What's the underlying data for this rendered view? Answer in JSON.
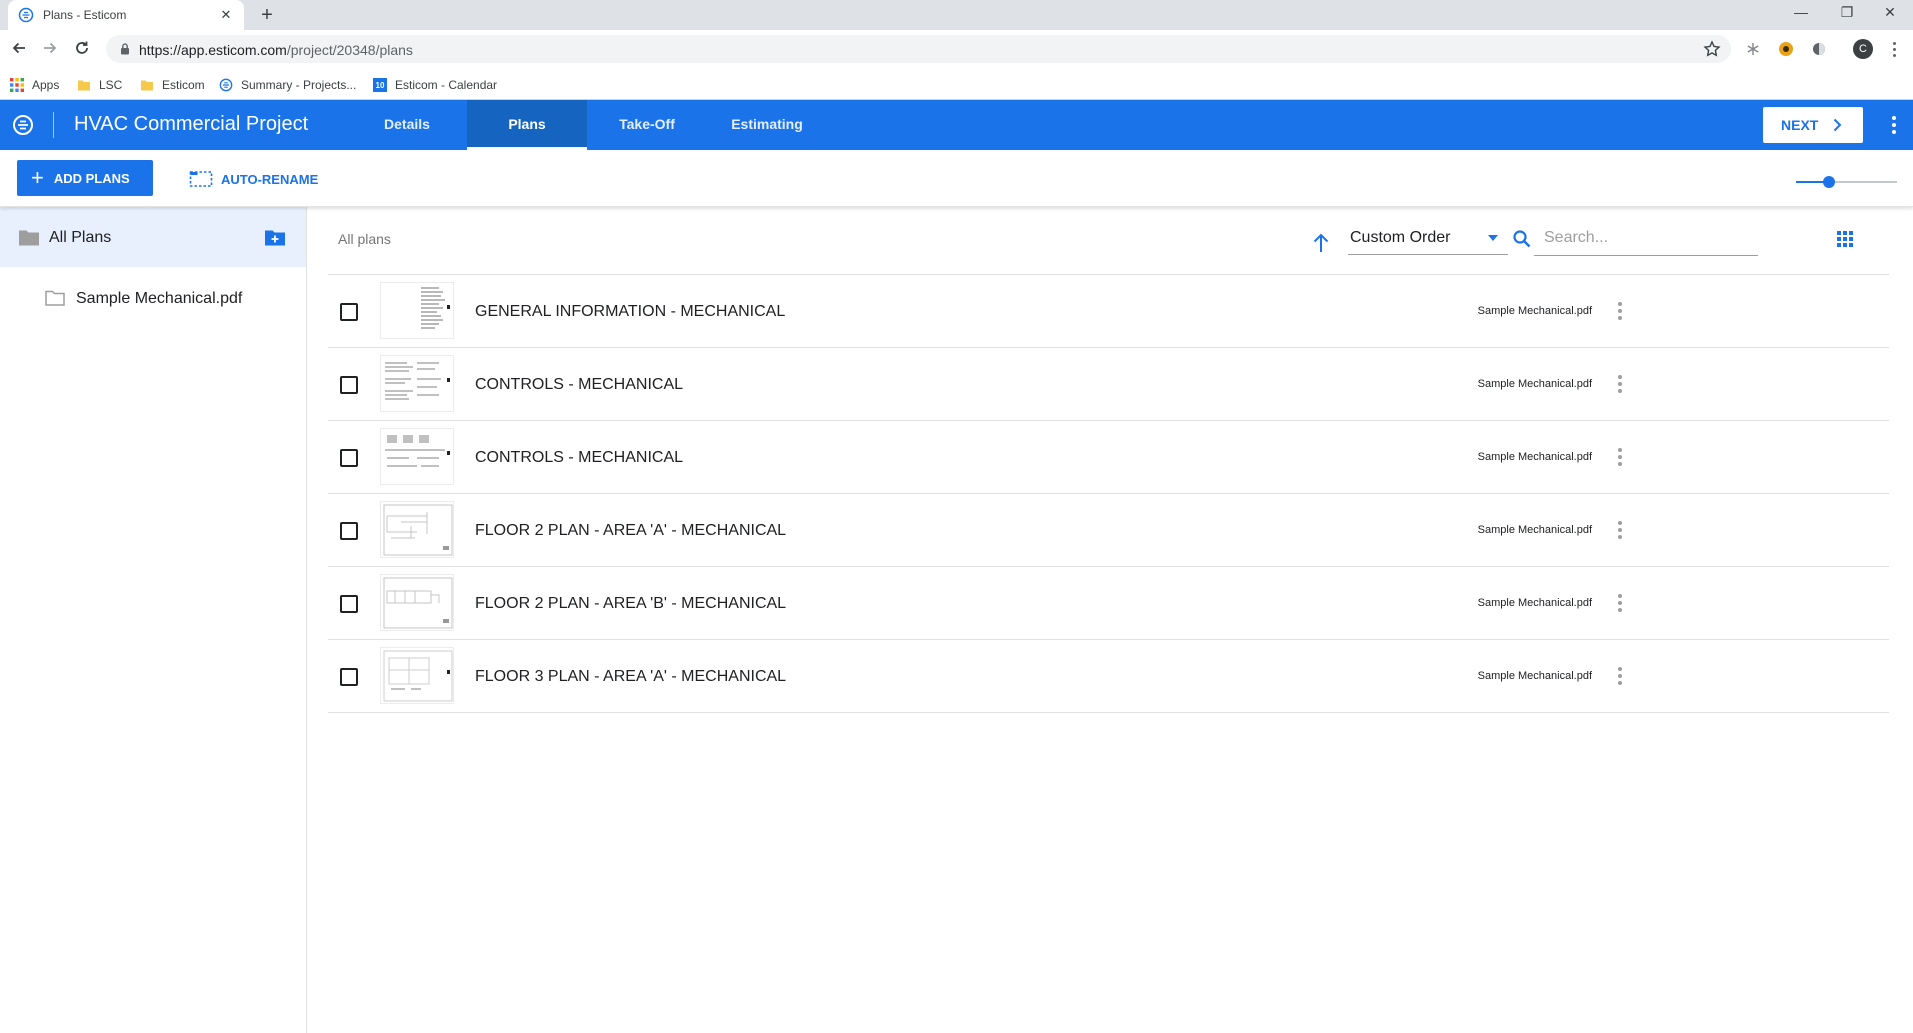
{
  "browser": {
    "tab_title": "Plans - Esticom",
    "tab_close": "✕",
    "new_tab": "+",
    "window_minimize": "—",
    "window_restore": "❐",
    "window_close": "✕",
    "url_host": "https://app.esticom.com",
    "url_path": "/project/20348/plans",
    "profile_initial": "C",
    "bookmarks": [
      {
        "label": "Apps",
        "icon": "apps-grid-icon"
      },
      {
        "label": "LSC",
        "icon": "folder-icon"
      },
      {
        "label": "Esticom",
        "icon": "folder-icon"
      },
      {
        "label": "Summary - Projects...",
        "icon": "esticom-logo-icon"
      },
      {
        "label": "Esticom - Calendar",
        "icon": "calendar-icon"
      }
    ],
    "calendar_day": "10"
  },
  "app": {
    "project_title": "HVAC Commercial Project",
    "tabs": [
      {
        "label": "Details",
        "active": false
      },
      {
        "label": "Plans",
        "active": true
      },
      {
        "label": "Take-Off",
        "active": false
      },
      {
        "label": "Estimating",
        "active": false
      }
    ],
    "next_label": "NEXT",
    "accent_color": "#1a73e8"
  },
  "actions": {
    "add_plans_label": "ADD PLANS",
    "add_plans_plus": "+",
    "auto_rename_label": "AUTO-RENAME",
    "zoom_level": 0.33
  },
  "sidebar": {
    "all_plans_label": "All Plans",
    "folders": [
      {
        "label": "Sample Mechanical.pdf"
      }
    ]
  },
  "main": {
    "breadcrumb": "All plans",
    "sort_value": "Custom Order",
    "search_placeholder": "Search...",
    "plans": [
      {
        "name": "GENERAL INFORMATION - MECHANICAL",
        "file": "Sample Mechanical.pdf"
      },
      {
        "name": "CONTROLS - MECHANICAL",
        "file": "Sample Mechanical.pdf"
      },
      {
        "name": "CONTROLS - MECHANICAL",
        "file": "Sample Mechanical.pdf"
      },
      {
        "name": "FLOOR 2 PLAN - AREA 'A' - MECHANICAL",
        "file": "Sample Mechanical.pdf"
      },
      {
        "name": "FLOOR 2 PLAN - AREA 'B' - MECHANICAL",
        "file": "Sample Mechanical.pdf"
      },
      {
        "name": "FLOOR 3 PLAN - AREA 'A' - MECHANICAL",
        "file": "Sample Mechanical.pdf"
      }
    ]
  }
}
